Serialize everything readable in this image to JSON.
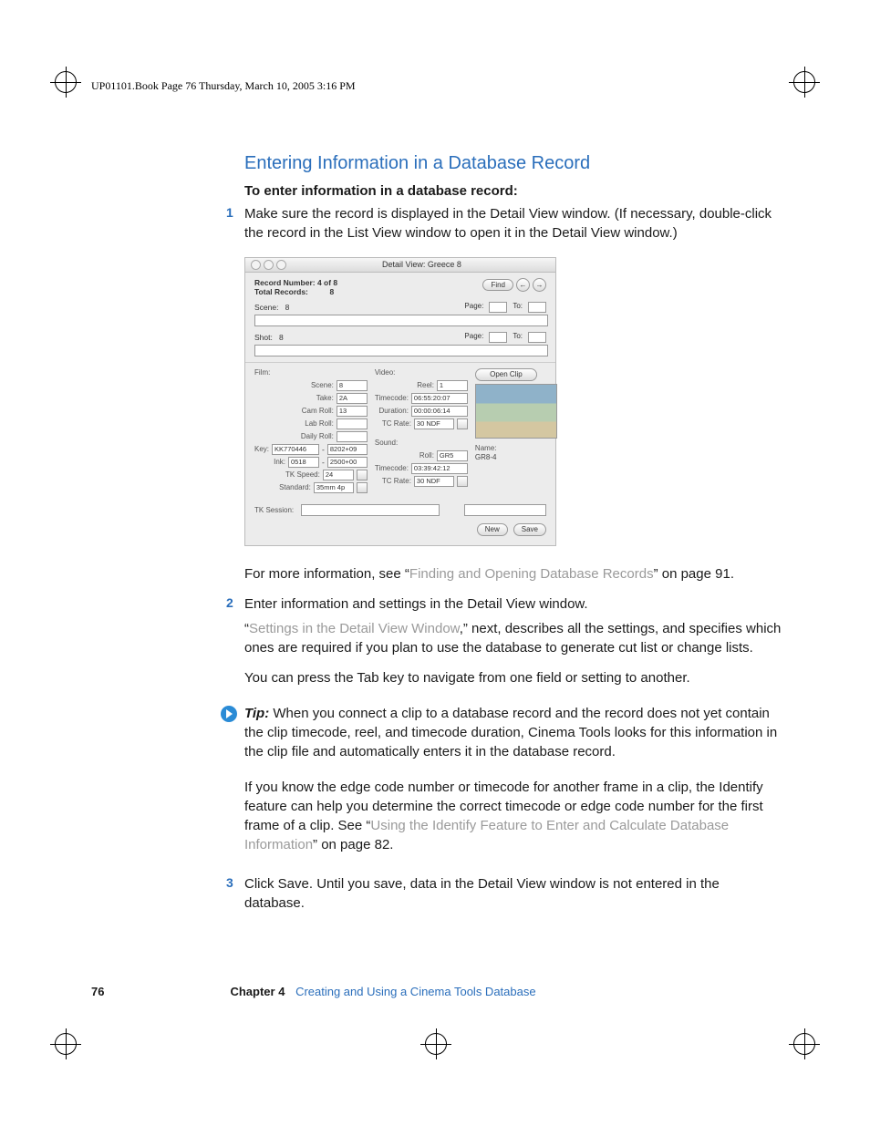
{
  "header_line": "UP01101.Book  Page 76  Thursday, March 10, 2005  3:16 PM",
  "title": "Entering Information in a Database Record",
  "intro": "To enter information in a database record:",
  "step1_num": "1",
  "step1": "Make sure the record is displayed in the Detail View window. (If necessary, double-click the record in the List View window to open it in the Detail View window.)",
  "dv": {
    "title": "Detail View: Greece 8",
    "rec_line": "Record Number: 4 of 8",
    "total_line_lbl": "Total Records:",
    "total_line_val": "8",
    "find": "Find",
    "scene_lbl": "Scene:",
    "scene_val": "8",
    "shot_lbl": "Shot:",
    "shot_val": "8",
    "page_lbl": "Page:",
    "to_lbl": "To:",
    "film": {
      "title": "Film:",
      "scene_l": "Scene:",
      "scene_v": "8",
      "take_l": "Take:",
      "take_v": "2A",
      "cam_l": "Cam Roll:",
      "cam_v": "13",
      "lab_l": "Lab Roll:",
      "lab_v": "",
      "daily_l": "Daily Roll:",
      "daily_v": "",
      "key_l": "Key:",
      "key_v1": "KK770446",
      "key_v2": "8202+09",
      "ink_l": "Ink:",
      "ink_v1": "0518",
      "ink_v2": "2500+00",
      "tk_l": "TK Speed:",
      "tk_v": "24",
      "std_l": "Standard:",
      "std_v": "35mm 4p"
    },
    "video": {
      "title": "Video:",
      "reel_l": "Reel:",
      "reel_v": "1",
      "tc_l": "Timecode:",
      "tc_v": "06:55:20:07",
      "dur_l": "Duration:",
      "dur_v": "00:00:06:14",
      "rate_l": "TC Rate:",
      "rate_v": "30 NDF"
    },
    "sound": {
      "title": "Sound:",
      "roll_l": "Roll:",
      "roll_v": "GR5",
      "tc_l": "Timecode:",
      "tc_v": "03:39:42:12",
      "rate_l": "TC Rate:",
      "rate_v": "30 NDF"
    },
    "open_clip": "Open Clip",
    "name_l": "Name:",
    "name_v": "GR8-4",
    "tk_session": "TK Session:",
    "new_btn": "New",
    "save_btn": "Save"
  },
  "after1a": "For more information, see “",
  "after1_link": "Finding and Opening Database Records",
  "after1b": "” on page 91.",
  "step2_num": "2",
  "step2": "Enter information and settings in the Detail View window.",
  "step2_pA": "“",
  "step2_link": "Settings in the Detail View Window",
  "step2_pB": ",” next, describes all the settings, and specifies which ones are required if you plan to use the database to generate cut list or change lists.",
  "step2_p2": "You can press the Tab key to navigate from one field or setting to another.",
  "tip_label": "Tip:",
  "tip_text": "  When you connect a clip to a database record and the record does not yet contain the clip timecode, reel, and timecode duration, Cinema Tools looks for this information in the clip file and automatically enters it in the database record.",
  "tip_p2a": "If you know the edge code number or timecode for another frame in a clip, the Identify feature can help you determine the correct timecode or edge code number for the first frame of a clip. See “",
  "tip_link": "Using the Identify Feature to Enter and Calculate Database Information",
  "tip_p2b": "” on page 82.",
  "step3_num": "3",
  "step3": "Click Save. Until you save, data in the Detail View window is not entered in the database.",
  "footer": {
    "page": "76",
    "chapter": "Chapter 4",
    "title": "Creating and Using a Cinema Tools Database"
  }
}
